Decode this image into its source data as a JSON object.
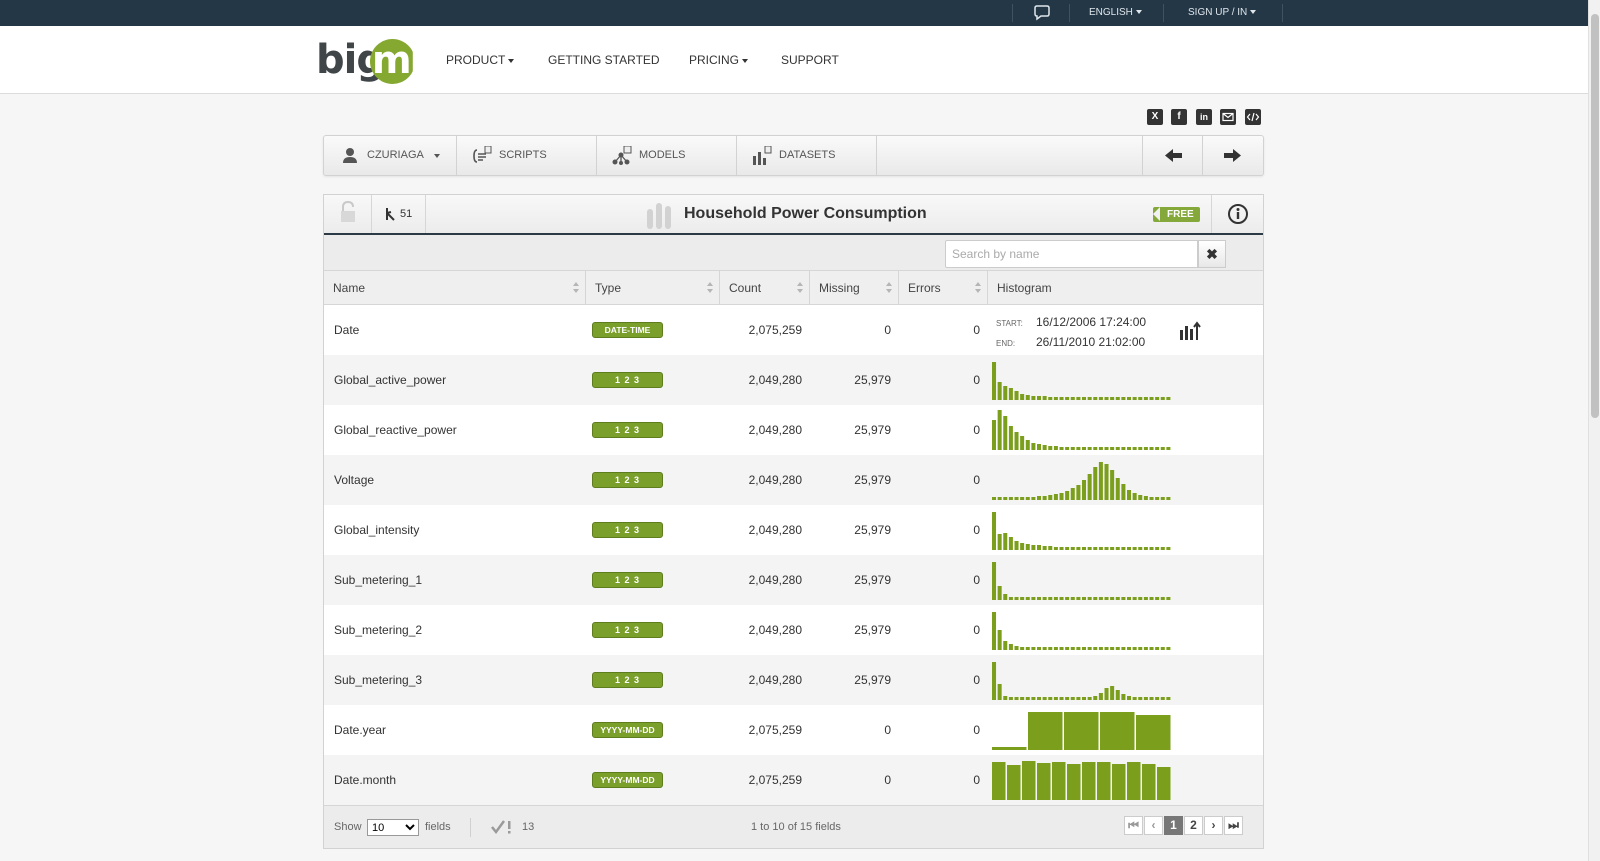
{
  "topbar": {
    "language_label": "ENGLISH",
    "signup_label": "SIGN UP / IN"
  },
  "nav": {
    "logo_big": "big",
    "logo_ml": "ml",
    "items": [
      {
        "label": "PRODUCT",
        "dropdown": true
      },
      {
        "label": "GETTING STARTED",
        "dropdown": false
      },
      {
        "label": "PRICING",
        "dropdown": true
      },
      {
        "label": "SUPPORT",
        "dropdown": false
      }
    ]
  },
  "share_icons": [
    "x-icon",
    "facebook-icon",
    "linkedin-icon",
    "email-icon",
    "embed-icon"
  ],
  "toolbar": {
    "user_label": "CZURIAGA",
    "scripts_label": "SCRIPTS",
    "models_label": "MODELS",
    "datasets_label": "DATASETS"
  },
  "dataset": {
    "title": "Household Power Consumption",
    "clone_count": "51",
    "price_badge": "FREE"
  },
  "search": {
    "placeholder": "Search by name"
  },
  "table": {
    "columns": [
      "Name",
      "Type",
      "Count",
      "Missing",
      "Errors",
      "Histogram"
    ],
    "rows": [
      {
        "name": "Date",
        "type": "DATE-TIME",
        "type_kind": "datetime",
        "count": "2,075,259",
        "missing": "0",
        "errors": "0",
        "date_range": {
          "start_label": "START:",
          "start": "16/12/2006 17:24:00",
          "end_label": "END:",
          "end": "26/11/2010 21:02:00"
        }
      },
      {
        "name": "Global_active_power",
        "type": "1 2 3",
        "type_kind": "numeric",
        "count": "2,049,280",
        "missing": "25,979",
        "errors": "0",
        "histogram": [
          38,
          18,
          14,
          12,
          9,
          6,
          5,
          4,
          4,
          4,
          3,
          3,
          3,
          3,
          3,
          3,
          3,
          3,
          3,
          3,
          3,
          3,
          3,
          3,
          3,
          3,
          3,
          3,
          3,
          3,
          3,
          3
        ]
      },
      {
        "name": "Global_reactive_power",
        "type": "1 2 3",
        "type_kind": "numeric",
        "count": "2,049,280",
        "missing": "25,979",
        "errors": "0",
        "histogram": [
          30,
          40,
          34,
          24,
          18,
          14,
          10,
          7,
          6,
          5,
          4,
          4,
          3,
          3,
          3,
          3,
          3,
          3,
          3,
          3,
          3,
          3,
          3,
          3,
          3,
          3,
          3,
          3,
          3,
          3,
          3,
          3
        ]
      },
      {
        "name": "Voltage",
        "type": "1 2 3",
        "type_kind": "numeric",
        "count": "2,049,280",
        "missing": "25,979",
        "errors": "0",
        "histogram": [
          3,
          3,
          3,
          3,
          3,
          3,
          3,
          3,
          4,
          4,
          5,
          6,
          7,
          9,
          12,
          15,
          20,
          26,
          33,
          38,
          36,
          30,
          22,
          16,
          10,
          7,
          5,
          4,
          3,
          3,
          3,
          3
        ]
      },
      {
        "name": "Global_intensity",
        "type": "1 2 3",
        "type_kind": "numeric",
        "count": "2,049,280",
        "missing": "25,979",
        "errors": "0",
        "histogram": [
          38,
          16,
          17,
          13,
          9,
          7,
          6,
          5,
          5,
          4,
          4,
          3,
          3,
          3,
          3,
          3,
          3,
          3,
          3,
          3,
          3,
          3,
          3,
          3,
          3,
          3,
          3,
          3,
          3,
          3,
          3,
          3
        ]
      },
      {
        "name": "Sub_metering_1",
        "type": "1 2 3",
        "type_kind": "numeric",
        "count": "2,049,280",
        "missing": "25,979",
        "errors": "0",
        "histogram": [
          38,
          14,
          6,
          3,
          3,
          3,
          3,
          3,
          3,
          3,
          3,
          3,
          3,
          3,
          3,
          3,
          3,
          3,
          3,
          3,
          3,
          3,
          3,
          3,
          3,
          3,
          3,
          3,
          3,
          3,
          3,
          3
        ]
      },
      {
        "name": "Sub_metering_2",
        "type": "1 2 3",
        "type_kind": "numeric",
        "count": "2,049,280",
        "missing": "25,979",
        "errors": "0",
        "histogram": [
          38,
          20,
          9,
          6,
          4,
          3,
          3,
          3,
          3,
          3,
          3,
          3,
          3,
          3,
          3,
          3,
          3,
          3,
          3,
          3,
          3,
          3,
          3,
          3,
          3,
          3,
          3,
          3,
          3,
          3,
          3,
          3
        ]
      },
      {
        "name": "Sub_metering_3",
        "type": "1 2 3",
        "type_kind": "numeric",
        "count": "2,049,280",
        "missing": "25,979",
        "errors": "0",
        "histogram": [
          38,
          16,
          4,
          3,
          3,
          3,
          3,
          3,
          3,
          3,
          3,
          3,
          3,
          3,
          3,
          3,
          3,
          3,
          4,
          7,
          12,
          14,
          10,
          6,
          4,
          3,
          3,
          3,
          3,
          3,
          3,
          3
        ]
      },
      {
        "name": "Date.year",
        "type": "YYYY-MM-DD",
        "type_kind": "datepart",
        "count": "2,075,259",
        "missing": "0",
        "errors": "0",
        "histogram": [
          3,
          38,
          38,
          38,
          35
        ]
      },
      {
        "name": "Date.month",
        "type": "YYYY-MM-DD",
        "type_kind": "datepart",
        "count": "2,075,259",
        "missing": "0",
        "errors": "0",
        "histogram": [
          38,
          35,
          39,
          37,
          38,
          36,
          38,
          38,
          36,
          38,
          36,
          33
        ]
      }
    ]
  },
  "footer": {
    "show_label": "Show",
    "show_value": "10",
    "fields_label": "fields",
    "check_count": "13",
    "range_text": "1 to 10 of 15 fields",
    "pages": [
      "1",
      "2"
    ],
    "current_page": "1"
  },
  "colors": {
    "accent": "#85a831",
    "bar": "#7b9f1d",
    "topbar": "#243746"
  }
}
